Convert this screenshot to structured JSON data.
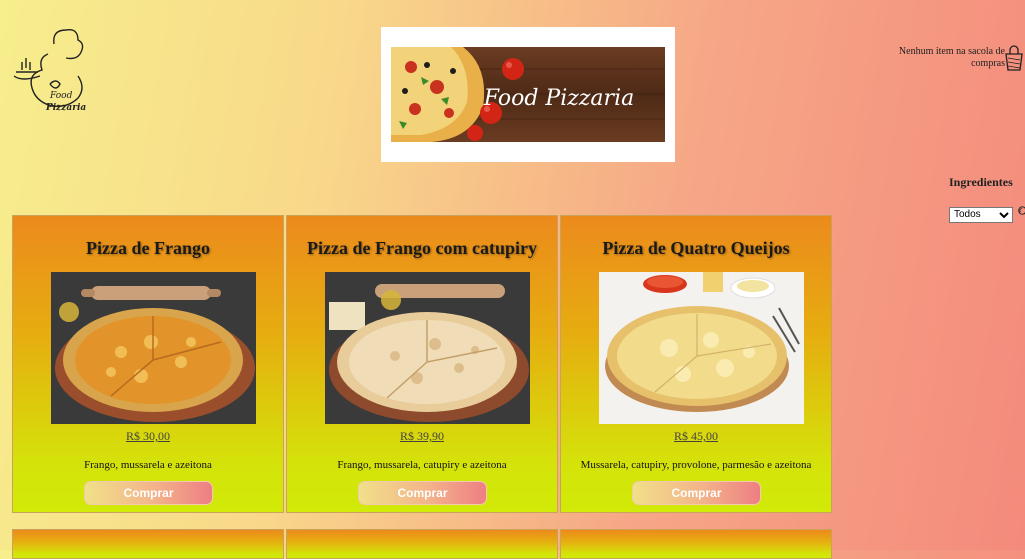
{
  "logo": {
    "icon": "chef-logo-icon",
    "alt": "Food Pizzaria"
  },
  "banner": {
    "title": "Food Pizzaria"
  },
  "cart": {
    "text": "Nenhum item na sacola de compras",
    "icon": "shopping-bag-icon"
  },
  "filter": {
    "label": "Ingredientes",
    "selected": "Todos",
    "options": [
      "Todos"
    ]
  },
  "products": [
    {
      "name": "Pizza de Frango",
      "price": "R$ 30,00",
      "description": "Frango, mussarela e azeitona",
      "button": "Comprar"
    },
    {
      "name": "Pizza de Frango com catupiry",
      "price": "R$ 39,90",
      "description": "Frango, mussarela, catupiry e azeitona",
      "button": "Comprar"
    },
    {
      "name": "Pizza de Quatro Queijos",
      "price": "R$ 45,00",
      "description": "Mussarela, catupiry, provolone, parmesão e azeitona",
      "button": "Comprar"
    }
  ]
}
